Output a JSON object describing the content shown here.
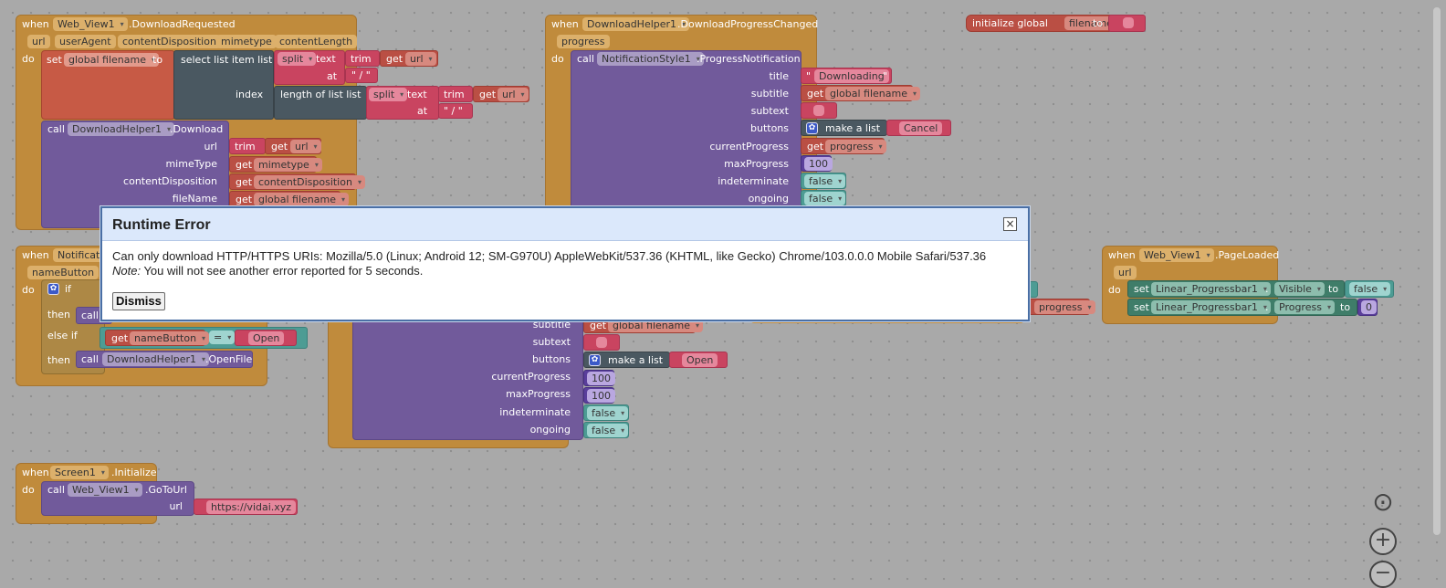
{
  "b1": {
    "when": "when",
    "comp": "Web_View1",
    "event": ".DownloadRequested",
    "params": [
      "url",
      "userAgent",
      "contentDisposition",
      "mimetype",
      "contentLength"
    ],
    "do": "do",
    "set": "set",
    "var": "global filename",
    "to": "to",
    "select": "select list item  list",
    "split": "split",
    "text": "text",
    "trim": "trim",
    "get": "get",
    "url": "url",
    "at": "at",
    "slash1": "\" / \"",
    "index": "index",
    "lenof": "length of list  list",
    "slash2": "\" / \""
  },
  "b1b": {
    "call": "call",
    "comp": "DownloadHelper1",
    "method": ".Download",
    "url_lbl": "url",
    "mime_lbl": "mimeType",
    "cd_lbl": "contentDisposition",
    "fn_lbl": "fileName",
    "trim": "trim",
    "get": "get",
    "url": "url",
    "mimetype": "mimetype",
    "cd": "contentDisposition",
    "gfn": "global filename"
  },
  "b2": {
    "when": "when",
    "comp": "DownloadHelper1",
    "event": ".DownloadProgressChanged",
    "param": "progress",
    "do": "do",
    "call": "call",
    "comp2": "NotificationStyle1",
    "method": ".ProgressNotification",
    "title_lbl": "title",
    "subtitle_lbl": "subtitle",
    "subtext_lbl": "subtext",
    "buttons_lbl": "buttons",
    "cur_lbl": "currentProgress",
    "max_lbl": "maxProgress",
    "ind_lbl": "indeterminate",
    "ong_lbl": "ongoing",
    "downloading": "Downloading",
    "get": "get",
    "gfn": "global filename",
    "makelist": "make a list",
    "cancel": "Cancel",
    "progress": "progress",
    "max": "100",
    "f1": "false",
    "f2": "false"
  },
  "b3": {
    "init": "initialize global",
    "name": "filename",
    "to": "to"
  },
  "b4": {
    "when": "when",
    "comp": "Notificatio",
    "param": "nameButton",
    "do": "do",
    "if": "if",
    "then": "then",
    "call": "call",
    "elseif": "else if",
    "get": "get",
    "nb": "nameButton",
    "eq": "=",
    "open": "Open",
    "then2": "then",
    "call2": "call",
    "comp2": "DownloadHelper1",
    "method": ".OpenFile"
  },
  "b5": {
    "subtitle_lbl": "subtitle",
    "get": "get",
    "gfn": "global filename",
    "subtext_lbl": "subtext",
    "buttons_lbl": "buttons",
    "makelist": "make a list",
    "open": "Open",
    "cur_lbl": "currentProgress",
    "cur": "100",
    "max_lbl": "maxProgress",
    "max": "100",
    "ind_lbl": "indeterminate",
    "ind": "false",
    "ong_lbl": "ongoing",
    "ong": "false"
  },
  "b6": {
    "progress": "progress"
  },
  "b7": {
    "when": "when",
    "comp": "Web_View1",
    "event": ".PageLoaded",
    "param": "url",
    "do": "do",
    "set": "set",
    "comp2": "Linear_Progressbar1",
    "prop1": "Visible",
    "to": "to",
    "val1": "false",
    "prop2": "Progress",
    "val2": "0"
  },
  "b8": {
    "when": "when",
    "comp": "Screen1",
    "event": ".Initialize",
    "do": "do",
    "call": "call",
    "comp2": "Web_View1",
    "method": ".GoToUrl",
    "url_lbl": "url",
    "url": "https://vidai.xyz"
  },
  "dialog": {
    "title": "Runtime Error",
    "message": "Can only download HTTP/HTTPS URIs: Mozilla/5.0 (Linux; Android 12; SM-G970U) AppleWebKit/537.36 (KHTML, like Gecko) Chrome/103.0.0.0 Mobile Safari/537.36",
    "note_label": "Note:",
    "note": " You will not see another error reported for 5 seconds.",
    "dismiss": "Dismiss",
    "close": "×"
  },
  "controls": {
    "center": "⊙",
    "zoom_in": "+",
    "zoom_out": "−"
  }
}
